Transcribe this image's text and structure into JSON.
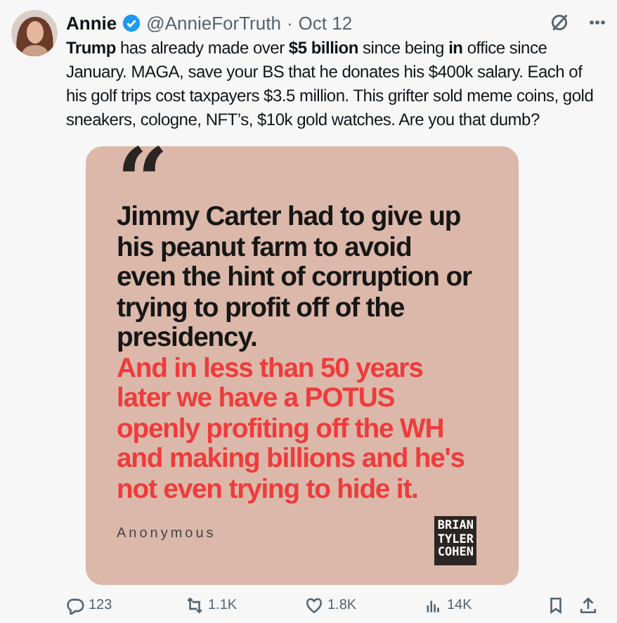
{
  "tweet": {
    "name": "Annie",
    "verified": true,
    "handle": "@AnnieForTruth",
    "separator": "·",
    "time": "Oct 12",
    "text": "**Trump** has already made over **$5 billion** since being **in** office since January. MAGA, save your BS that he donates his $400k salary. Each of his golf trips cost taxpayers $3.5 million. This grifter sold meme coins, gold sneakers, cologne, NFT’s, $10k gold watches. Are you that dumb?",
    "quote_card": {
      "mark": "“",
      "lines": [
        {
          "text": "Jimmy Carter had to give up his peanut farm to avoid even the hint of corruption or trying to profit off of the presidency.",
          "color": "#161616"
        },
        {
          "text": "And in less than 50 years later we have a POTUS openly profiting off the WH and making billions and he's not even trying to hide it.",
          "color": "#ef3b3b"
        }
      ],
      "author": "Anonymous",
      "logo": [
        "BRIAN",
        "TYLER",
        "COHEN"
      ]
    },
    "actions": [
      {
        "kind": "reply",
        "count": "123"
      },
      {
        "kind": "retweet",
        "count": "1.1K"
      },
      {
        "kind": "like",
        "count": "1.8K"
      },
      {
        "kind": "views",
        "count": "14K"
      }
    ]
  }
}
